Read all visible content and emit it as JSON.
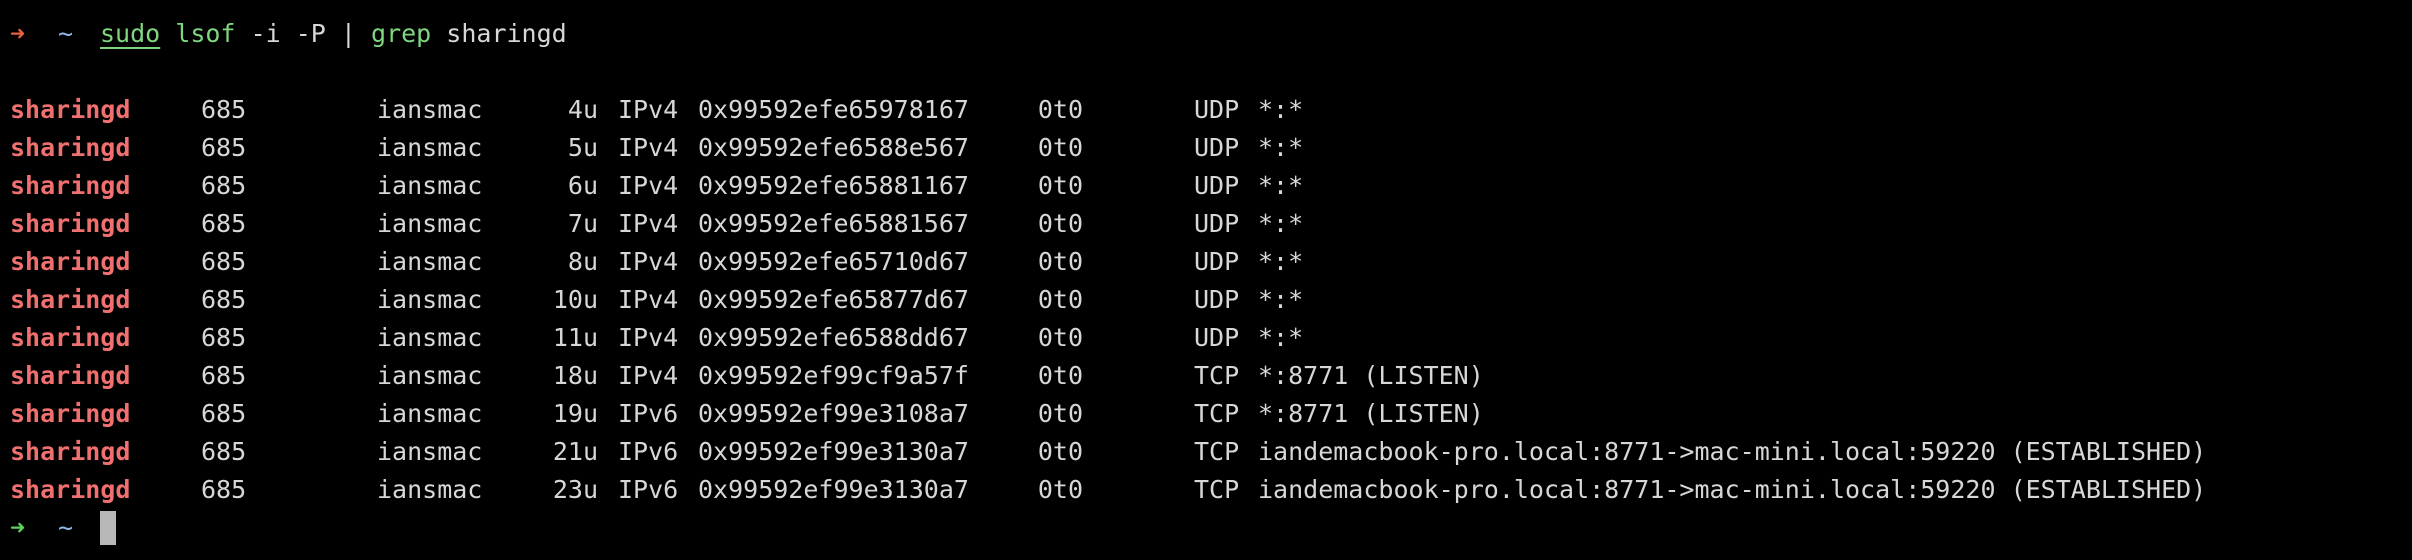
{
  "terminal": {
    "prompt_symbol": "➜",
    "cwd": "~",
    "command": {
      "sudo": "sudo",
      "lsof": "lsof",
      "args": "-i -P",
      "pipe": "|",
      "grep": "grep",
      "pattern": "sharingd"
    },
    "rows": [
      {
        "command": "sharingd",
        "pid": "685",
        "user": "iansmac",
        "fd": "4u",
        "type": "IPv4",
        "device": "0x99592efe65978167",
        "size": "0t0",
        "node": "UDP",
        "name": "*:*"
      },
      {
        "command": "sharingd",
        "pid": "685",
        "user": "iansmac",
        "fd": "5u",
        "type": "IPv4",
        "device": "0x99592efe6588e567",
        "size": "0t0",
        "node": "UDP",
        "name": "*:*"
      },
      {
        "command": "sharingd",
        "pid": "685",
        "user": "iansmac",
        "fd": "6u",
        "type": "IPv4",
        "device": "0x99592efe65881167",
        "size": "0t0",
        "node": "UDP",
        "name": "*:*"
      },
      {
        "command": "sharingd",
        "pid": "685",
        "user": "iansmac",
        "fd": "7u",
        "type": "IPv4",
        "device": "0x99592efe65881567",
        "size": "0t0",
        "node": "UDP",
        "name": "*:*"
      },
      {
        "command": "sharingd",
        "pid": "685",
        "user": "iansmac",
        "fd": "8u",
        "type": "IPv4",
        "device": "0x99592efe65710d67",
        "size": "0t0",
        "node": "UDP",
        "name": "*:*"
      },
      {
        "command": "sharingd",
        "pid": "685",
        "user": "iansmac",
        "fd": "10u",
        "type": "IPv4",
        "device": "0x99592efe65877d67",
        "size": "0t0",
        "node": "UDP",
        "name": "*:*"
      },
      {
        "command": "sharingd",
        "pid": "685",
        "user": "iansmac",
        "fd": "11u",
        "type": "IPv4",
        "device": "0x99592efe6588dd67",
        "size": "0t0",
        "node": "UDP",
        "name": "*:*"
      },
      {
        "command": "sharingd",
        "pid": "685",
        "user": "iansmac",
        "fd": "18u",
        "type": "IPv4",
        "device": "0x99592ef99cf9a57f",
        "size": "0t0",
        "node": "TCP",
        "name": "*:8771 (LISTEN)"
      },
      {
        "command": "sharingd",
        "pid": "685",
        "user": "iansmac",
        "fd": "19u",
        "type": "IPv6",
        "device": "0x99592ef99e3108a7",
        "size": "0t0",
        "node": "TCP",
        "name": "*:8771 (LISTEN)"
      },
      {
        "command": "sharingd",
        "pid": "685",
        "user": "iansmac",
        "fd": "21u",
        "type": "IPv6",
        "device": "0x99592ef99e3130a7",
        "size": "0t0",
        "node": "TCP",
        "name": "iandemacbook-pro.local:8771->mac-mini.local:59220 (ESTABLISHED)"
      },
      {
        "command": "sharingd",
        "pid": "685",
        "user": "iansmac",
        "fd": "23u",
        "type": "IPv6",
        "device": "0x99592ef99e3130a7",
        "size": "0t0",
        "node": "TCP",
        "name": "iandemacbook-pro.local:8771->mac-mini.local:59220 (ESTABLISHED)"
      }
    ],
    "colors": {
      "background": "#000000",
      "arrow_error": "#e8623f",
      "arrow_ok": "#5fd35f",
      "command_name": "#f07070",
      "command_green": "#7fd67f",
      "text": "#d7d7d7"
    }
  }
}
